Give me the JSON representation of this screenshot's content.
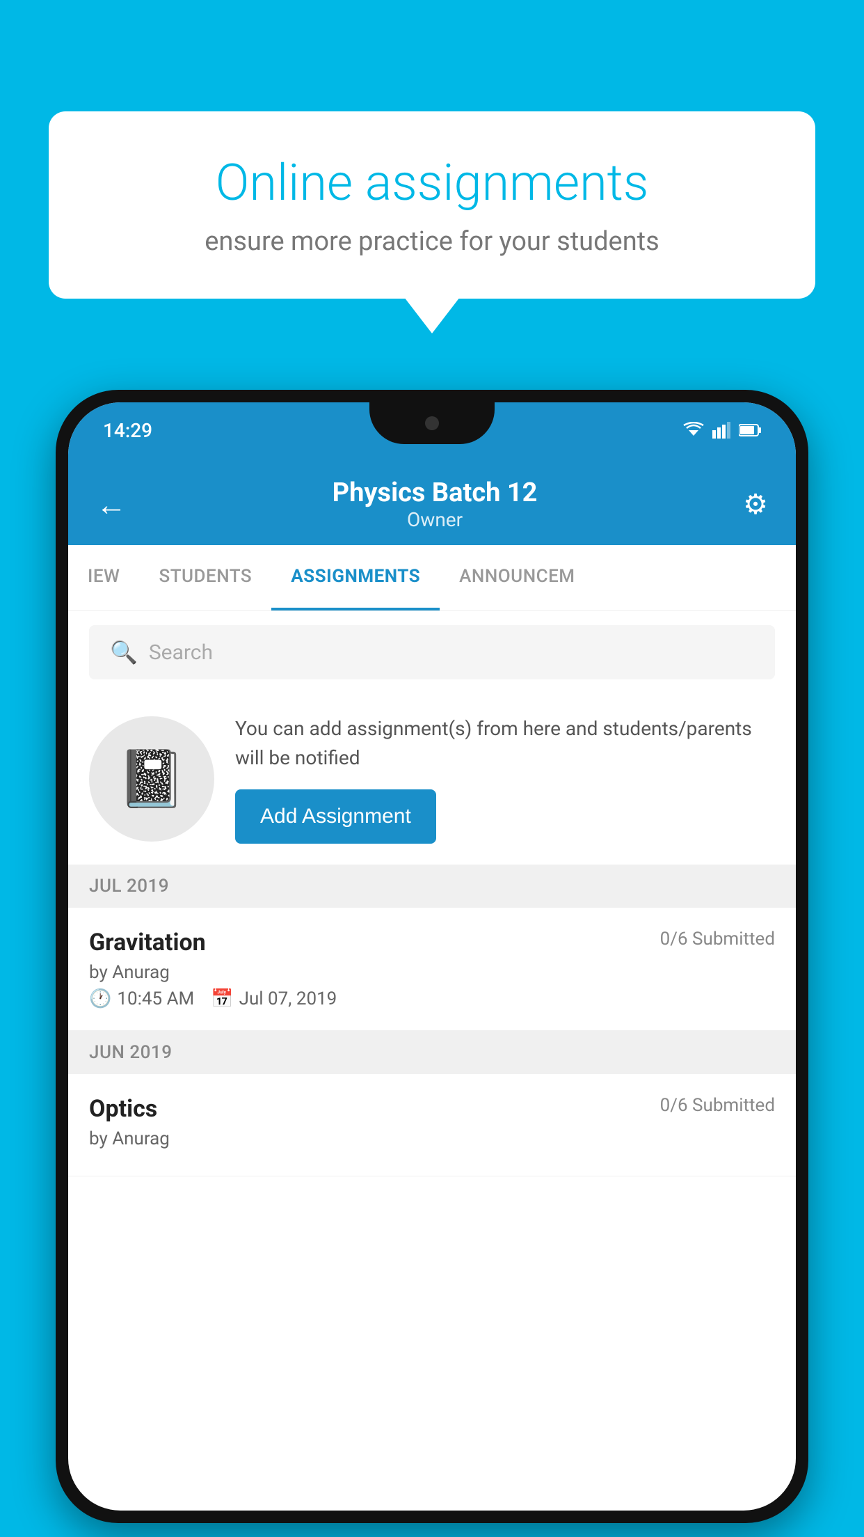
{
  "background_color": "#00b8e6",
  "speech_bubble": {
    "title": "Online assignments",
    "subtitle": "ensure more practice for your students"
  },
  "status_bar": {
    "time": "14:29"
  },
  "app_header": {
    "title": "Physics Batch 12",
    "subtitle": "Owner",
    "back_label": "←",
    "settings_label": "⚙"
  },
  "tabs": [
    {
      "label": "IEW",
      "active": false
    },
    {
      "label": "STUDENTS",
      "active": false
    },
    {
      "label": "ASSIGNMENTS",
      "active": true
    },
    {
      "label": "ANNOUNCEM",
      "active": false
    }
  ],
  "search": {
    "placeholder": "Search"
  },
  "info_section": {
    "description": "You can add assignment(s) from here and students/parents will be notified",
    "add_button_label": "Add Assignment"
  },
  "assignment_sections": [
    {
      "month_label": "JUL 2019",
      "assignments": [
        {
          "name": "Gravitation",
          "submitted": "0/6 Submitted",
          "by": "by Anurag",
          "time": "10:45 AM",
          "date": "Jul 07, 2019"
        }
      ]
    },
    {
      "month_label": "JUN 2019",
      "assignments": [
        {
          "name": "Optics",
          "submitted": "0/6 Submitted",
          "by": "by Anurag",
          "time": "",
          "date": ""
        }
      ]
    }
  ]
}
